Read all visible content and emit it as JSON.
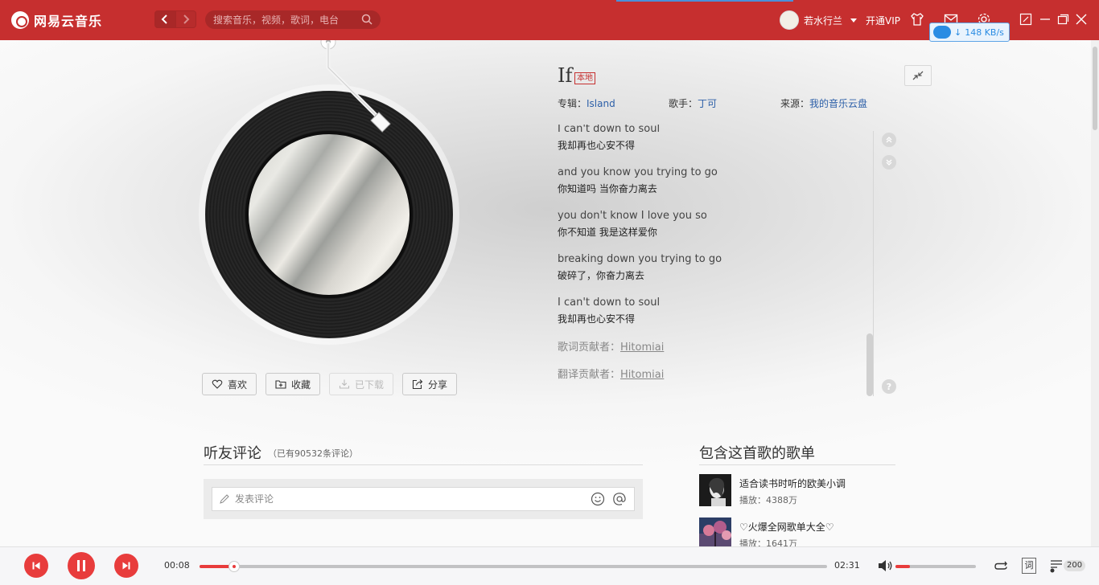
{
  "app": {
    "name": "网易云音乐"
  },
  "search": {
    "placeholder": "搜索音乐，视频，歌词，电台"
  },
  "user": {
    "name": "若水行兰",
    "vip_label": "开通VIP"
  },
  "download": {
    "speed": "148 KB/s"
  },
  "song": {
    "title": "If",
    "tag": "本地",
    "album_label": "专辑：",
    "album": "Island",
    "artist_label": "歌手：",
    "artist": "丁可",
    "source_label": "来源：",
    "source": "我的音乐云盘"
  },
  "lyrics": [
    {
      "en": "I can't down to soul",
      "cn": "我却再也心安不得"
    },
    {
      "en": "and you know you trying to go",
      "cn": "你知道吗 当你奋力离去"
    },
    {
      "en": "you don't know I love you so",
      "cn": "你不知道 我是这样爱你"
    },
    {
      "en": "breaking down you trying to go",
      "cn": "破碎了，你奋力离去"
    },
    {
      "en": "I can't down to soul",
      "cn": "我却再也心安不得"
    }
  ],
  "credits": {
    "lyric_label": "歌词贡献者：",
    "lyric_name": "Hitomiai",
    "trans_label": "翻译贡献者：",
    "trans_name": "Hitomiai"
  },
  "actions": {
    "like": "喜欢",
    "collect": "收藏",
    "download": "已下载",
    "share": "分享"
  },
  "comments": {
    "title": "听友评论",
    "count": "（已有90532条评论）",
    "placeholder": "发表评论"
  },
  "playlists": {
    "title": "包含这首歌的歌单",
    "items": [
      {
        "name": "适合读书时听的欧美小调",
        "plays": "播放：4388万"
      },
      {
        "name": "♡火爆全网歌单大全♡",
        "plays": "播放：1641万"
      }
    ]
  },
  "player": {
    "current": "00:08",
    "total": "02:31",
    "progress": 0.055,
    "volume": 0.18,
    "lyric_btn": "词",
    "queue_count": "200"
  },
  "colors": {
    "brand": "#c62f2f",
    "accent": "#e83c3c",
    "link": "#2c5fa8"
  }
}
